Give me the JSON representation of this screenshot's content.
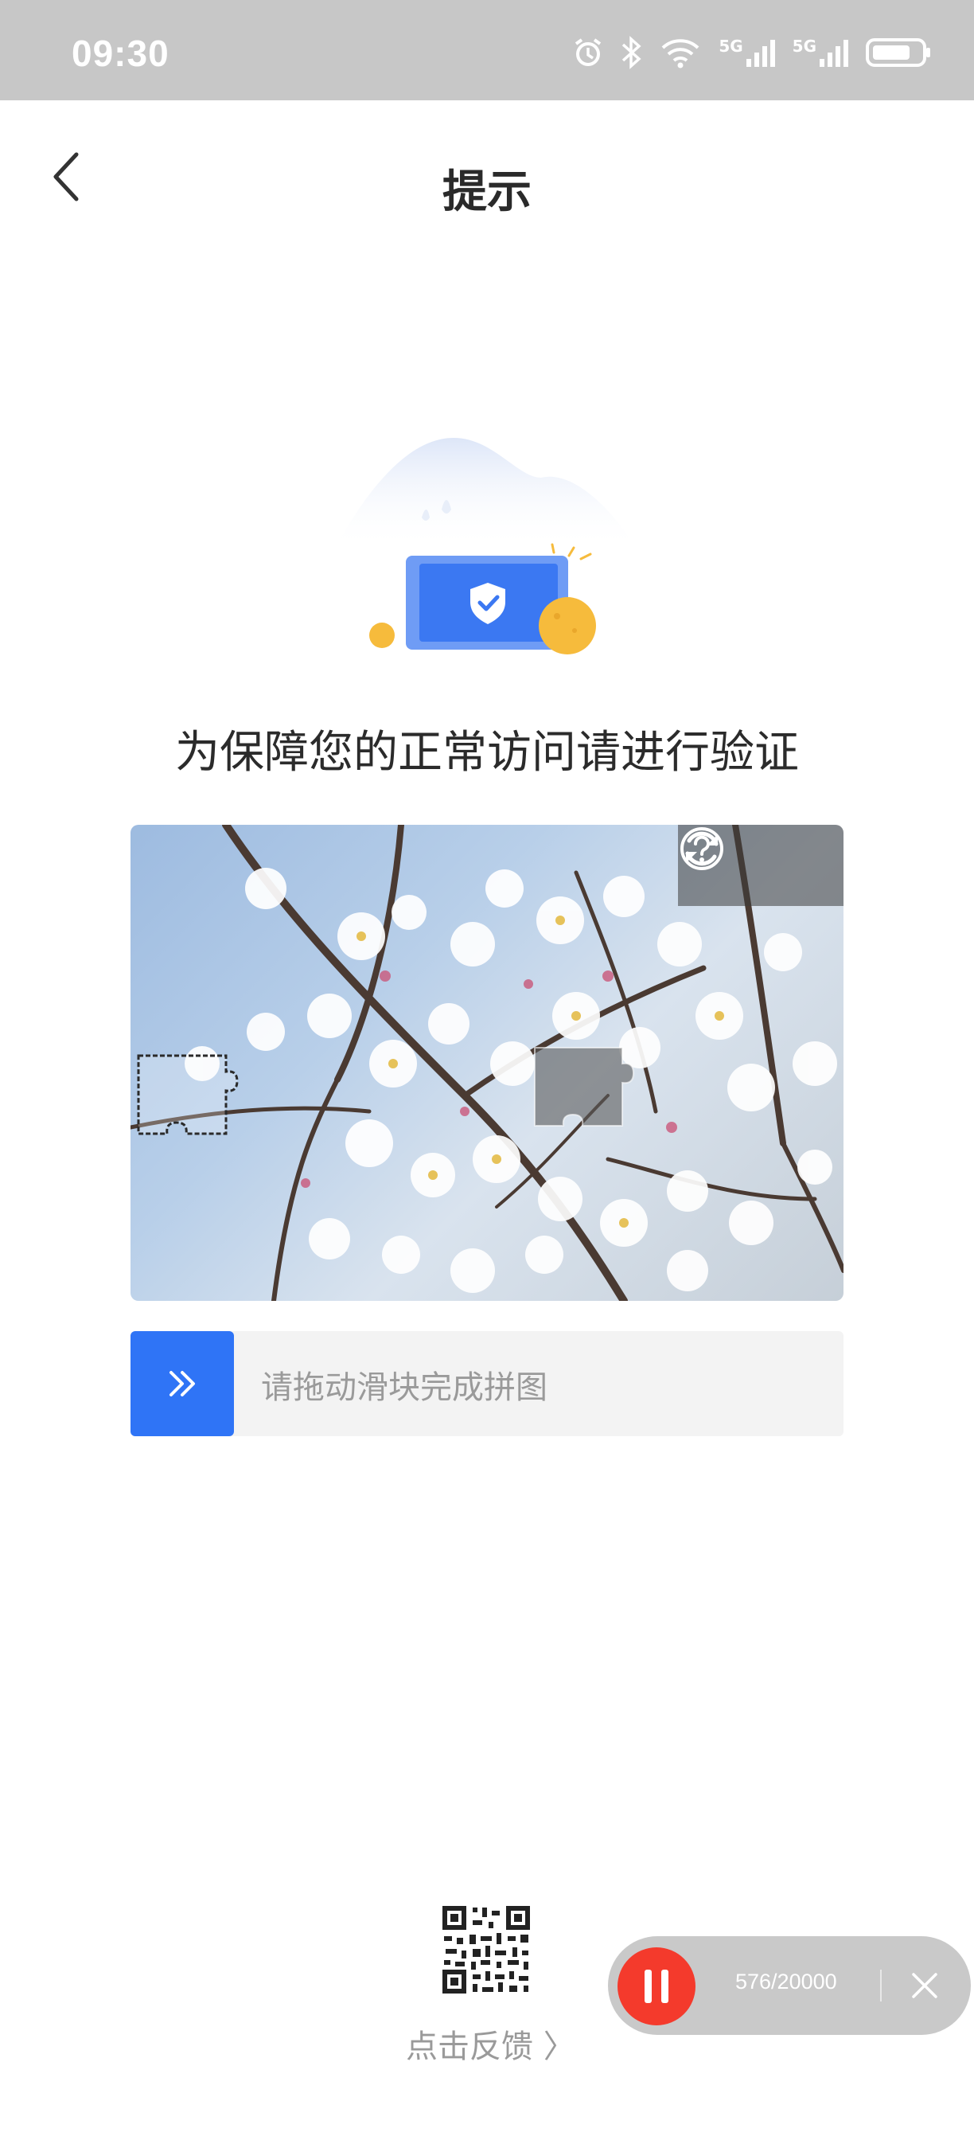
{
  "status_bar": {
    "time": "09:30",
    "icons": [
      "alarm-icon",
      "bluetooth-icon",
      "wifi-icon",
      "signal-5g-icon",
      "signal-5g-icon",
      "battery-icon"
    ],
    "network_label_1": "5G",
    "network_label_2": "5G"
  },
  "header": {
    "title": "提示",
    "back_icon": "chevron-left-icon"
  },
  "illustration": {
    "icon": "security-shield-icon"
  },
  "verification": {
    "headline": "为保障您的正常访问请进行验证",
    "tools": [
      "help-icon",
      "refresh-icon"
    ],
    "slider_hint": "请拖动滑块完成拼图",
    "slider_icon": "double-chevron-right-icon"
  },
  "feedback": {
    "label": "点击反馈 〉",
    "qr_icon": "qr-code-icon"
  },
  "recorder": {
    "count": "576/20000",
    "pause_icon": "pause-icon",
    "close_icon": "close-icon",
    "accent": "#f43a2c"
  },
  "colors": {
    "primary": "#2f74f6",
    "status_bar": "#c7c7c7"
  }
}
